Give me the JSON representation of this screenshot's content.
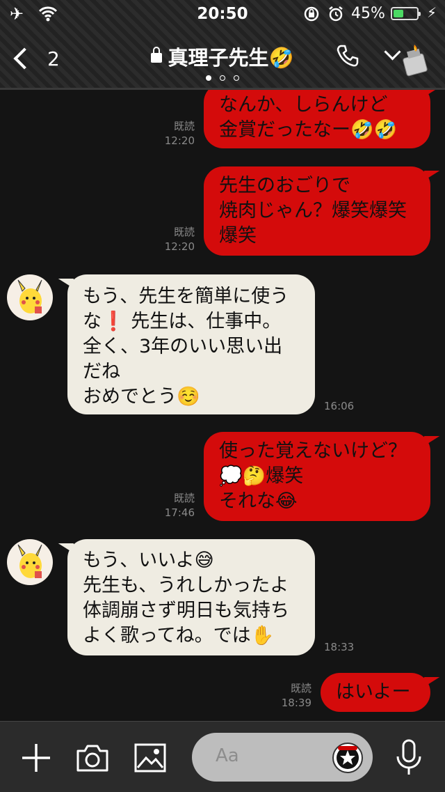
{
  "status_bar": {
    "time": "20:50",
    "battery_percent": "45%",
    "battery_level": 0.45,
    "icons": [
      "airplane-icon",
      "wifi-icon",
      "rotation-lock-icon",
      "alarm-icon",
      "battery-icon",
      "charging-icon"
    ]
  },
  "header": {
    "back_count": "2",
    "title": "真理子先生🤣",
    "page_dots": 3,
    "active_dot": 0,
    "icons": [
      "back-chevron-icon",
      "lock-icon",
      "phone-icon",
      "chevron-down-icon",
      "lighter-icon"
    ]
  },
  "messages": [
    {
      "side": "out",
      "lines": [
        "なんか、しらんけど",
        "金賞だったなー🤣🤣"
      ],
      "read": "既読",
      "time": "12:20"
    },
    {
      "side": "out",
      "lines": [
        "先生のおごりで",
        "焼肉じゃん？爆笑爆笑",
        "爆笑"
      ],
      "read": "既読",
      "time": "12:20"
    },
    {
      "side": "in",
      "lines": [
        "もう、先生を簡単に使う",
        "な❗ 先生は、仕事中。",
        "全く、3年のいい思い出",
        "だね",
        "おめでとう☺️"
      ],
      "time": "16:06"
    },
    {
      "side": "out",
      "lines": [
        "使った覚えないけど？",
        "💭🤔爆笑",
        "それな😂"
      ],
      "read": "既読",
      "time": "17:46"
    },
    {
      "side": "in",
      "lines": [
        "もう、いいよ😅",
        "先生も、うれしかったよ",
        "体調崩さず明日も気持ち",
        "よく歌ってね。では✋"
      ],
      "time": "18:33"
    },
    {
      "side": "out",
      "lines": [
        "はいよー"
      ],
      "read": "既読",
      "time": "18:39"
    }
  ],
  "composer": {
    "placeholder": "Aa",
    "icons": [
      "plus-icon",
      "camera-icon",
      "image-icon",
      "sticker-icon",
      "microphone-icon"
    ]
  },
  "colors": {
    "outgoing_bubble": "#d40b0b",
    "incoming_bubble": "#efece2",
    "background": "#141414"
  }
}
